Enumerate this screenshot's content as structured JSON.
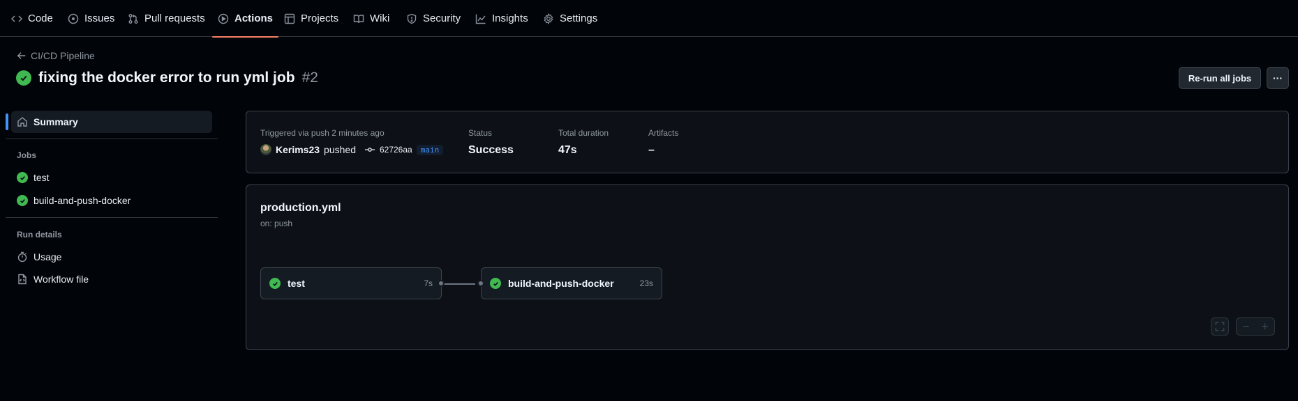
{
  "nav": {
    "tabs": [
      {
        "label": "Code",
        "icon": "code-icon"
      },
      {
        "label": "Issues",
        "icon": "issue-icon"
      },
      {
        "label": "Pull requests",
        "icon": "pull-request-icon"
      },
      {
        "label": "Actions",
        "icon": "play-icon",
        "active": true
      },
      {
        "label": "Projects",
        "icon": "table-icon"
      },
      {
        "label": "Wiki",
        "icon": "book-icon"
      },
      {
        "label": "Security",
        "icon": "shield-icon"
      },
      {
        "label": "Insights",
        "icon": "graph-icon"
      },
      {
        "label": "Settings",
        "icon": "gear-icon"
      }
    ]
  },
  "header": {
    "back_label": "CI/CD Pipeline",
    "title": "fixing the docker error to run yml job",
    "run_number": "#2",
    "rerun_label": "Re-run all jobs",
    "more_label": "···"
  },
  "sidebar": {
    "summary_label": "Summary",
    "jobs_heading": "Jobs",
    "jobs": [
      {
        "label": "test",
        "status": "success"
      },
      {
        "label": "build-and-push-docker",
        "status": "success"
      }
    ],
    "run_details_heading": "Run details",
    "details": [
      {
        "label": "Usage",
        "icon": "stopwatch-icon"
      },
      {
        "label": "Workflow file",
        "icon": "file-code-icon"
      }
    ]
  },
  "summary": {
    "trigger_text": "Triggered via push 2 minutes ago",
    "user": "Kerims23",
    "action": "pushed",
    "commit": "62726aa",
    "branch": "main",
    "status_label": "Status",
    "status_value": "Success",
    "duration_label": "Total duration",
    "duration_value": "47s",
    "artifacts_label": "Artifacts",
    "artifacts_value": "–"
  },
  "workflow": {
    "file": "production.yml",
    "trigger": "on: push",
    "jobs": [
      {
        "name": "test",
        "duration": "7s",
        "status": "success"
      },
      {
        "name": "build-and-push-docker",
        "duration": "23s",
        "status": "success"
      }
    ]
  },
  "colors": {
    "success": "#3fb950",
    "accent": "#4493f8",
    "active_tab_underline": "#f78166",
    "background": "#010409"
  }
}
